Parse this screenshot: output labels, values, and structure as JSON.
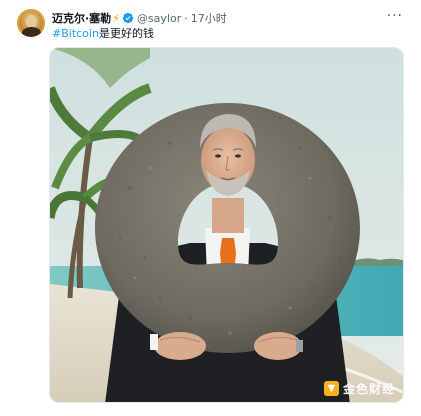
{
  "tweet": {
    "author_name": "迈克尔·塞勒",
    "author_badge_icon": "lightning-bolt-icon",
    "verified_icon": "verified-badge-icon",
    "handle": "@saylor",
    "separator": "·",
    "time": "17小时",
    "more_icon": "more-options-icon",
    "hashtag": "#Bitcoin",
    "text_rest": "是更好的钱"
  },
  "photo": {
    "description_icon": "tweet-photo",
    "watermark_text": "金色财经",
    "watermark_icon": "jinse-logo-icon"
  },
  "colors": {
    "link": "#1d9bf0",
    "secondary_text": "#536471",
    "verified_blue": "#1d9bf0",
    "bolt": "#f2a900",
    "tie": "#e8701a"
  }
}
